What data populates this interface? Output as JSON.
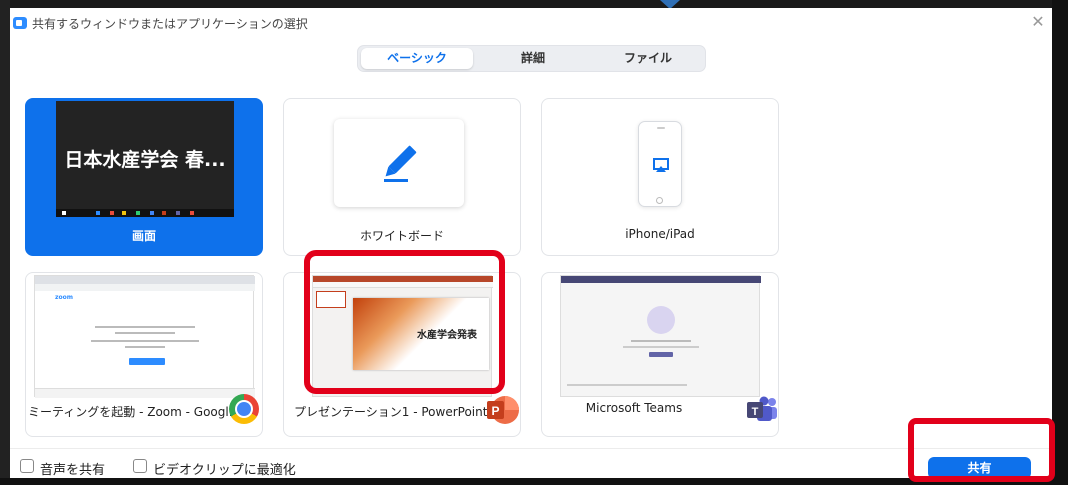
{
  "window": {
    "title": "共有するウィンドウまたはアプリケーションの選択",
    "close_icon": "close-icon"
  },
  "tabs": [
    {
      "label": "ベーシック",
      "active": true
    },
    {
      "label": "詳細",
      "active": false
    },
    {
      "label": "ファイル",
      "active": false
    }
  ],
  "tiles": [
    {
      "label": "画面",
      "preview_text": "日本水産学会 春...",
      "selected": true
    },
    {
      "label": "ホワイトボード",
      "icon": "pencil-icon"
    },
    {
      "label": "iPhone/iPad",
      "icon": "iphone-airplay-icon"
    },
    {
      "label": "ミーティングを起動 - Zoom - Googl...",
      "app_icon": "chrome-icon",
      "preview_logo": "zoom"
    },
    {
      "label": "プレゼンテーション1 - PowerPoint",
      "app_icon": "powerpoint-icon",
      "preview_title": "水産学会発表",
      "highlighted": true
    },
    {
      "label": "Microsoft Teams",
      "app_icon": "teams-icon"
    }
  ],
  "footer": {
    "share_audio": {
      "label": "音声を共有",
      "checked": false
    },
    "optimize_video": {
      "label": "ビデオクリップに最適化",
      "checked": false
    },
    "share_button": "共有"
  },
  "colors": {
    "accent": "#0e71eb",
    "highlight": "#e2001a",
    "powerpoint": "#c43e1c",
    "teams": "#464775"
  }
}
